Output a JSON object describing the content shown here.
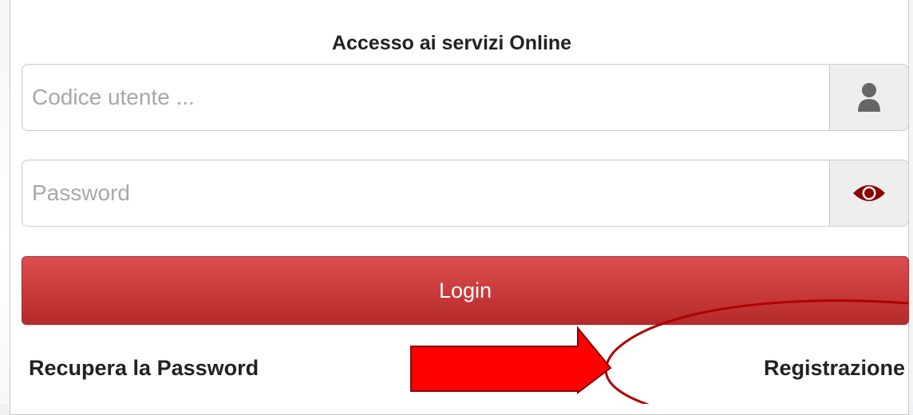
{
  "form": {
    "title": "Accesso ai servizi Online",
    "username": {
      "value": "",
      "placeholder": "Codice utente ...",
      "icon": "user-icon"
    },
    "password": {
      "value": "",
      "placeholder": "Password",
      "icon": "eye-icon"
    },
    "login_label": "Login",
    "recover_label": "Recupera la Password",
    "register_label": "Registrazione"
  },
  "annotation": {
    "arrow_color": "#ff0000",
    "ellipse_color": "#b00000"
  },
  "colors": {
    "accent": "#c93a3a",
    "eye_icon": "#8b0000",
    "user_icon": "#666666"
  }
}
